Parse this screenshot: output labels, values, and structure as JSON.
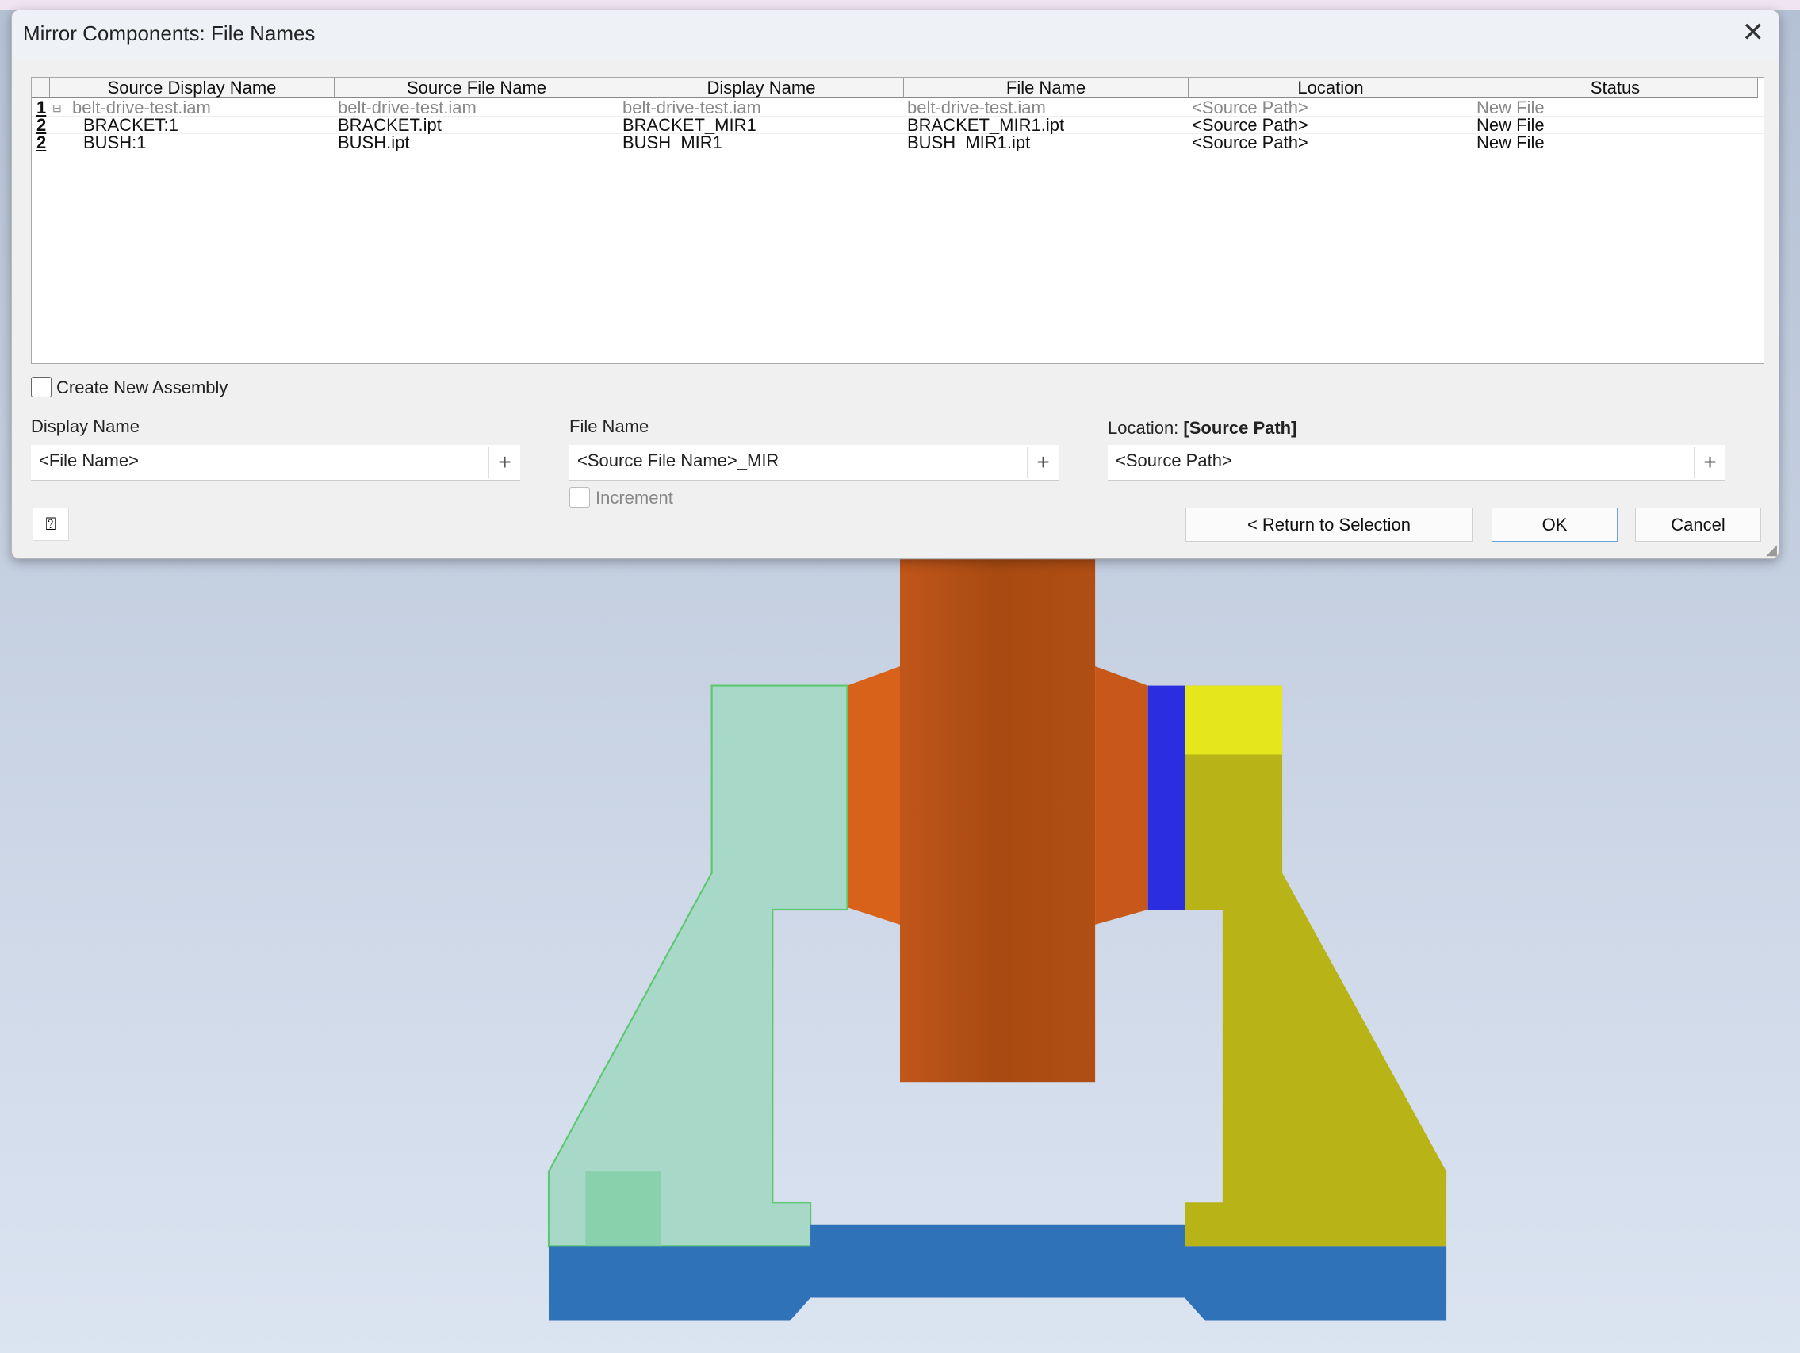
{
  "dialog": {
    "title": "Mirror Components: File Names",
    "close_icon": "close-icon"
  },
  "table": {
    "columns": [
      "Source Display Name",
      "Source File Name",
      "Display Name",
      "File Name",
      "Location",
      "Status"
    ],
    "rows": [
      {
        "level": "1",
        "cells": [
          "belt-drive-test.iam",
          "belt-drive-test.iam",
          "belt-drive-test.iam",
          "belt-drive-test.iam",
          "<Source Path>",
          "New File"
        ],
        "dimmed": true
      },
      {
        "level": "2",
        "cells": [
          "BRACKET:1",
          "BRACKET.ipt",
          "BRACKET_MIR1",
          "BRACKET_MIR1.ipt",
          "<Source Path>",
          "New File"
        ]
      },
      {
        "level": "2",
        "cells": [
          "BUSH:1",
          "BUSH.ipt",
          "BUSH_MIR1",
          "BUSH_MIR1.ipt",
          "<Source Path>",
          "New File"
        ]
      }
    ]
  },
  "options": {
    "create_new_assembly": "Create New Assembly",
    "create_new_assembly_checked": false,
    "increment": "Increment",
    "increment_checked": false
  },
  "fields": {
    "display_name_label": "Display Name",
    "display_name_value": "<File Name>",
    "file_name_label": "File Name",
    "file_name_value": "<Source File Name>_MIR",
    "location_label": "Location:",
    "location_bold": "[Source Path]",
    "location_value": "<Source Path>"
  },
  "buttons": {
    "return": "< Return to Selection",
    "ok": "OK",
    "cancel": "Cancel"
  },
  "colors": {
    "hub": "#b04e14",
    "ring": "#2a2ee0",
    "bracket_right": "#b8b418",
    "bracket_mirrored": "#a8d8c8",
    "base": "#2f72b8"
  }
}
